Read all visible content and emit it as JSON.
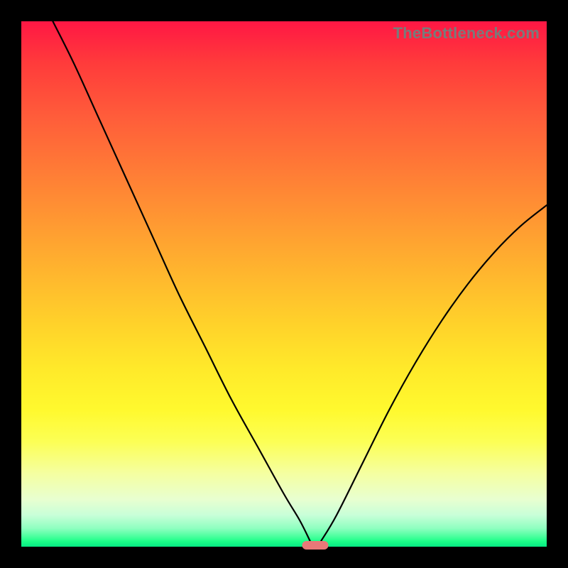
{
  "attribution": "TheBottleneck.com",
  "colors": {
    "marker": "#e87878",
    "curve": "#000000",
    "frame": "#000000"
  },
  "chart_data": {
    "type": "line",
    "title": "",
    "xlabel": "",
    "ylabel": "",
    "xlim": [
      0,
      100
    ],
    "ylim": [
      0,
      100
    ],
    "minimum_marker": {
      "x": 56,
      "y": 0
    },
    "series": [
      {
        "name": "left-branch",
        "x": [
          6,
          10,
          15,
          20,
          25,
          30,
          35,
          40,
          45,
          50,
          53,
          55
        ],
        "y": [
          100,
          92,
          81,
          70,
          59,
          48,
          38,
          28,
          19,
          10,
          5,
          1
        ]
      },
      {
        "name": "right-branch",
        "x": [
          57,
          60,
          65,
          70,
          75,
          80,
          85,
          90,
          95,
          100
        ],
        "y": [
          1,
          6,
          16,
          26,
          35,
          43,
          50,
          56,
          61,
          65
        ]
      }
    ],
    "annotations": [
      {
        "text": "TheBottleneck.com",
        "position": "top-right"
      }
    ]
  }
}
